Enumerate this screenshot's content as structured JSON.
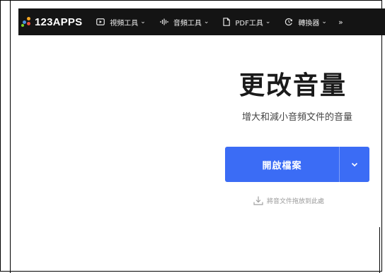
{
  "brand": {
    "name": "123APPS",
    "dot_colors": [
      "#f5a623",
      "#4a90e2",
      "#e94e3c",
      "#7ed321"
    ]
  },
  "nav": {
    "items": [
      {
        "label": "視頻工具",
        "icon": "video-icon"
      },
      {
        "label": "音頻工具",
        "icon": "audio-wave-icon"
      },
      {
        "label": "PDF工具",
        "icon": "document-icon"
      },
      {
        "label": "轉換器",
        "icon": "convert-icon"
      }
    ],
    "more_icon": "more-icon"
  },
  "main": {
    "title": "更改音量",
    "subtitle": "增大和減小音頻文件的音量",
    "open_button_label": "開啟檔案",
    "drop_hint": "將音文件拖放到此處"
  },
  "colors": {
    "nav_bg": "#141414",
    "primary": "#3b6cf5"
  }
}
